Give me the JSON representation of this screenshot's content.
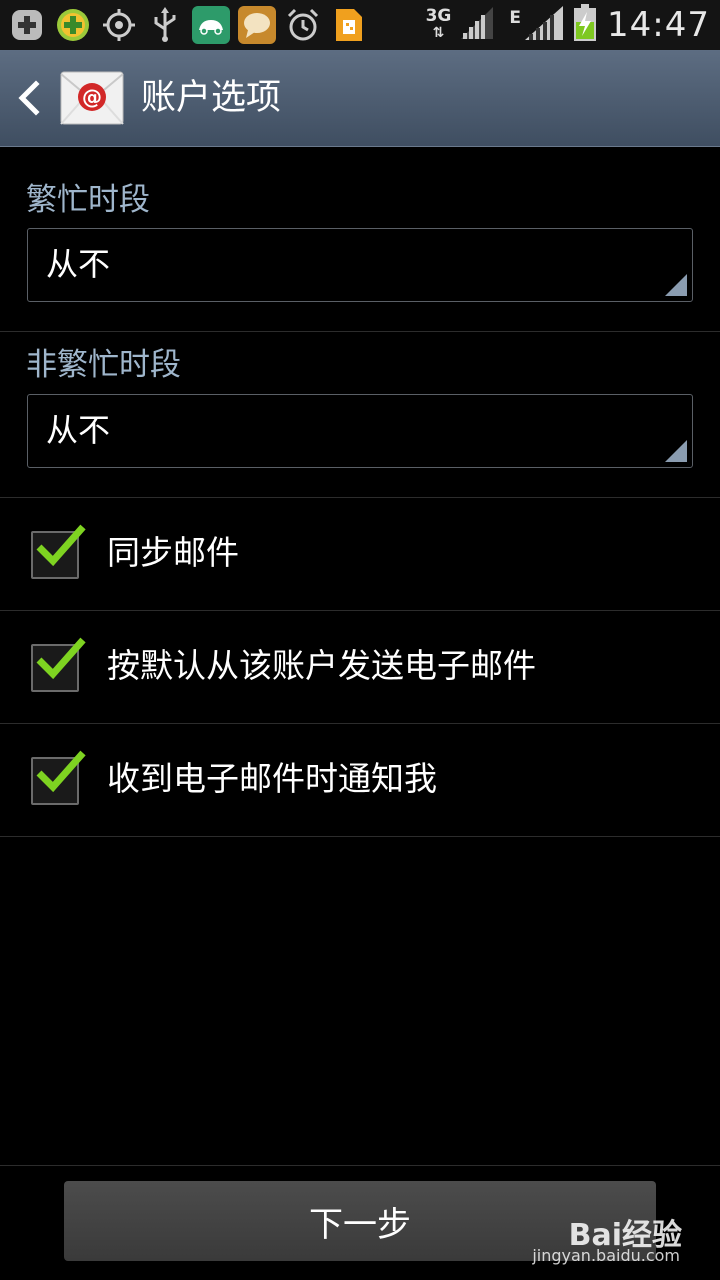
{
  "status_bar": {
    "icons": [
      "add-icon",
      "game-icon",
      "gps-icon",
      "usb-icon",
      "car-icon",
      "chat-icon",
      "alarm-icon",
      "sim-card-icon"
    ],
    "network_3g": "3G",
    "network_e": "E",
    "time": "14:47"
  },
  "action_bar": {
    "title": "账户选项"
  },
  "sections": [
    {
      "label": "繁忙时段",
      "value": "从不"
    },
    {
      "label": "非繁忙时段",
      "value": "从不"
    }
  ],
  "options": [
    {
      "label": "同步邮件",
      "checked": true
    },
    {
      "label": "按默认从该账户发送电子邮件",
      "checked": true
    },
    {
      "label": "收到电子邮件时通知我",
      "checked": true
    }
  ],
  "next_button": {
    "label": "下一步"
  },
  "watermark": {
    "brand": "Bai经验",
    "url": "jingyan.baidu.com"
  },
  "colors": {
    "accent": "#9fb6cc",
    "check": "#7ed321",
    "actionbar": "#4d5c70"
  }
}
